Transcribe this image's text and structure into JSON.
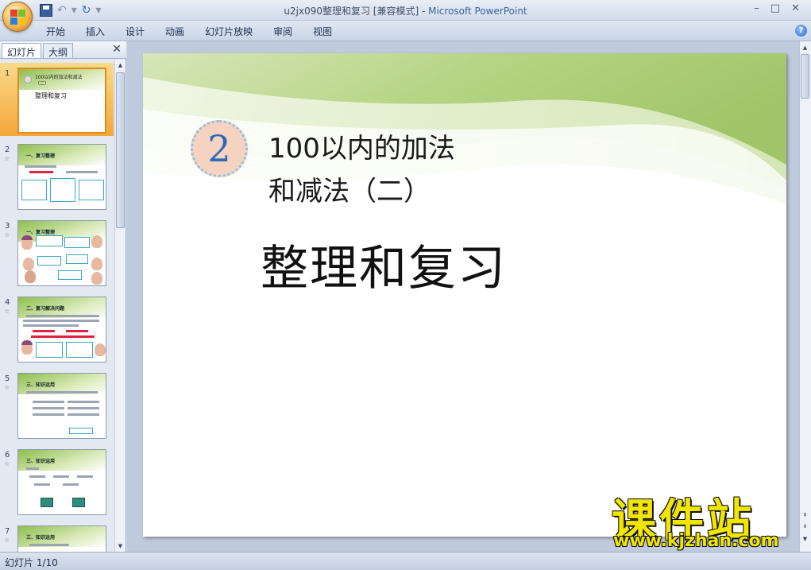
{
  "window": {
    "title": "u2jx090整理和复习 [兼容模式] - ",
    "app_name": "Microsoft PowerPoint"
  },
  "quick_access": {
    "icons": [
      "save-icon",
      "undo-icon",
      "redo-icon",
      "customize-icon"
    ]
  },
  "ribbon": {
    "tabs": [
      "开始",
      "插入",
      "设计",
      "动画",
      "幻灯片放映",
      "审阅",
      "视图"
    ]
  },
  "left_panel": {
    "tab_slides": "幻灯片",
    "tab_outline": "大纲",
    "slides": [
      {
        "num": "1",
        "star": "",
        "heading": "100以内的加法和减法（二）",
        "sub": "整理和复习"
      },
      {
        "num": "2",
        "star": "☆",
        "heading": "一、复习整理"
      },
      {
        "num": "3",
        "star": "☆",
        "heading": "一、复习整理"
      },
      {
        "num": "4",
        "star": "☆",
        "heading": "二、复习解决问题"
      },
      {
        "num": "5",
        "star": "☆",
        "heading": "三、知识运用"
      },
      {
        "num": "6",
        "star": "☆",
        "heading": "三、知识运用"
      },
      {
        "num": "7",
        "star": "☆",
        "heading": "三、知识运用"
      }
    ]
  },
  "slide": {
    "unit_number": "2",
    "title_line1": "100以内的加法",
    "title_line2": "和减法（二）",
    "subtitle": "整理和复习"
  },
  "status": {
    "slide_indicator": "幻灯片 1/10"
  },
  "watermark": {
    "brand": "课件站",
    "url": "www.kjzhan.com"
  },
  "colors": {
    "accent_green": "#9cc45a",
    "badge_blue": "#2a6ab8",
    "selection_orange": "#f3a73b"
  }
}
